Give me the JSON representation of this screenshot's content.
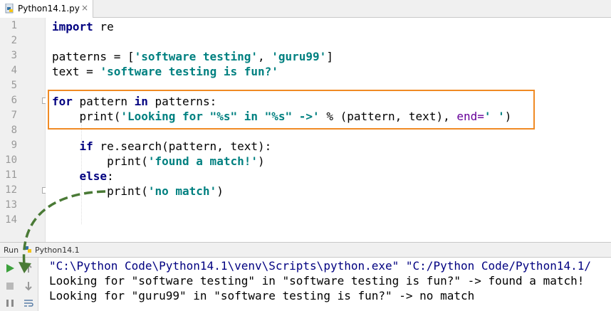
{
  "tab": {
    "filename": "Python14.1.py",
    "icon": "python-file-icon",
    "close": "×"
  },
  "line_numbers": [
    "1",
    "2",
    "3",
    "4",
    "5",
    "6",
    "7",
    "8",
    "9",
    "10",
    "11",
    "12",
    "13",
    "14"
  ],
  "code": {
    "l1_kw": "import",
    "l1_rest": " re",
    "l3_a": "patterns = [",
    "l3_s1": "'software testing'",
    "l3_b": ", ",
    "l3_s2": "'guru99'",
    "l3_c": "]",
    "l4_a": "text = ",
    "l4_s": "'software testing is fun?'",
    "l6_kw1": "for",
    "l6_a": " pattern ",
    "l6_kw2": "in",
    "l6_b": " patterns:",
    "l7_a": "    print(",
    "l7_s": "'Looking for \"%s\" in \"%s\" ->'",
    "l7_b": " % (pattern, text), ",
    "l7_p": "end=",
    "l7_s2": "' '",
    "l7_c": ")",
    "l9_a": "    ",
    "l9_kw": "if",
    "l9_b": " re.search(pattern, text):",
    "l10_a": "        print(",
    "l10_s": "'found a match!'",
    "l10_b": ")",
    "l11_a": "    ",
    "l11_kw": "else",
    "l11_b": ":",
    "l12_a": "        print(",
    "l12_s": "'no match'",
    "l12_b": ")"
  },
  "run_panel": {
    "label": "Run",
    "config": "Python14.1",
    "config_icon": "python-file-icon"
  },
  "console": {
    "lines": [
      "\"C:\\Python Code\\Python14.1\\venv\\Scripts\\python.exe\" \"C:/Python Code/Python14.1/",
      "Looking for \"software testing\" in \"software testing is fun?\" -> found a match!",
      "Looking for \"guru99\" in \"software testing is fun?\" -> no match"
    ]
  },
  "tools": {
    "run": "run-icon",
    "up": "up-arrow-icon",
    "stop": "stop-icon",
    "down": "down-arrow-icon",
    "pause": "pause-icon",
    "wrap": "soft-wrap-icon"
  },
  "colors": {
    "highlight_box": "#f08a24",
    "arrow": "#4a7a36",
    "keyword": "#000080",
    "string": "#008080"
  }
}
